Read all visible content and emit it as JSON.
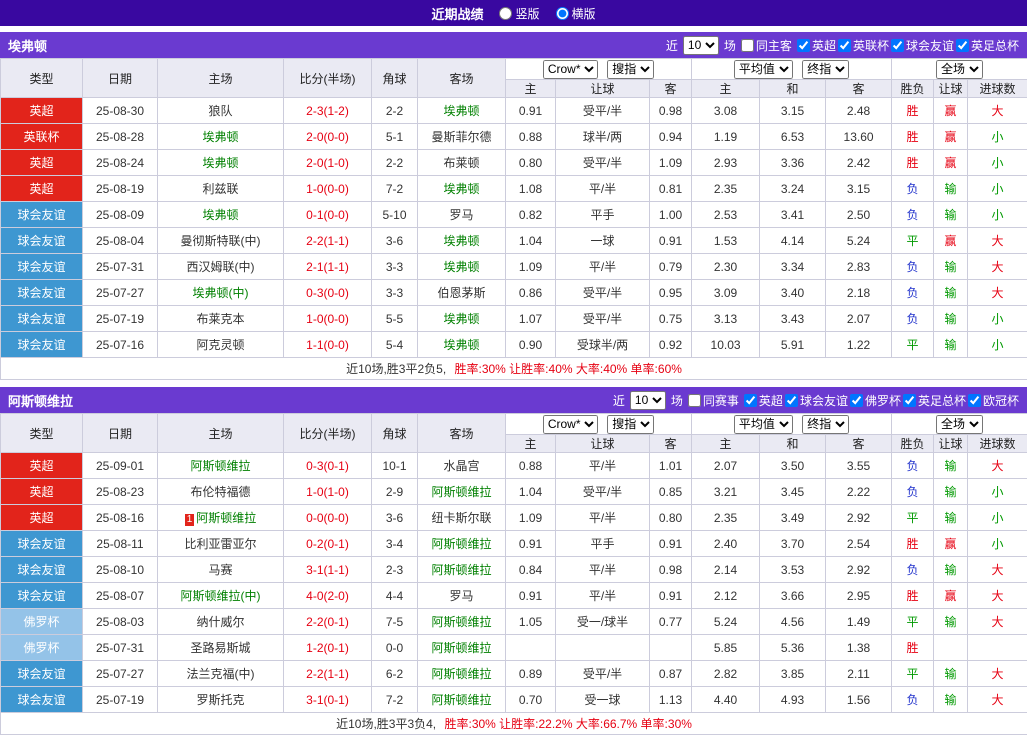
{
  "topbar": {
    "title": "近期战绩",
    "vertical": "竖版",
    "horizontal": "横版"
  },
  "filter_labels": {
    "near": "近",
    "unit": "场"
  },
  "table_header": {
    "type": "类型",
    "date": "日期",
    "home": "主场",
    "score": "比分(半场)",
    "corner": "角球",
    "away": "客场",
    "bookmaker": "Crow*",
    "odds_mode": "搜指",
    "avg": "平均值",
    "final_mode": "终指",
    "scope": "全场",
    "odds_home": "主",
    "odds_handicap": "让球",
    "odds_away": "客",
    "avg_home": "主",
    "avg_draw": "和",
    "avg_away": "客",
    "result_wl": "胜负",
    "result_handicap": "让球",
    "result_goals": "进球数"
  },
  "colors": {
    "top_bar": "#3908a0",
    "accent_bar": "#6a3ad0",
    "score": "#e60012",
    "featured_team": "#008000",
    "type_bg": {
      "英超": "#e2241b",
      "英联杯": "#e2241b",
      "球会友谊": "#3e97d1",
      "佛罗杯": "#94c3e8"
    },
    "result": {
      "胜": "#e60012",
      "平": "#009900",
      "负": "#2233cc",
      "赢": "#e60012",
      "输": "#009900",
      "大": "#e60012",
      "小": "#009900"
    }
  },
  "sections": [
    {
      "team": "埃弗顿",
      "filter": {
        "count": "10",
        "same_label": "同主客",
        "leagues": [
          "英超",
          "英联杯",
          "球会友谊",
          "英足总杯"
        ]
      },
      "rows": [
        {
          "type": "英超",
          "date": "25-08-30",
          "home": "狼队",
          "home_f": false,
          "score": "2-3(1-2)",
          "corner": "2-2",
          "away": "埃弗顿",
          "away_f": true,
          "o1": "0.91",
          "hcap": "受平/半",
          "o2": "0.98",
          "a1": "3.08",
          "a2": "3.15",
          "a3": "2.48",
          "wl": "胜",
          "hr": "赢",
          "gr": "大"
        },
        {
          "type": "英联杯",
          "date": "25-08-28",
          "home": "埃弗顿",
          "home_f": true,
          "score": "2-0(0-0)",
          "corner": "5-1",
          "away": "曼斯菲尔德",
          "away_f": false,
          "o1": "0.88",
          "hcap": "球半/两",
          "o2": "0.94",
          "a1": "1.19",
          "a2": "6.53",
          "a3": "13.60",
          "wl": "胜",
          "hr": "赢",
          "gr": "小"
        },
        {
          "type": "英超",
          "date": "25-08-24",
          "home": "埃弗顿",
          "home_f": true,
          "score": "2-0(1-0)",
          "corner": "2-2",
          "away": "布莱顿",
          "away_f": false,
          "o1": "0.80",
          "hcap": "受平/半",
          "o2": "1.09",
          "a1": "2.93",
          "a2": "3.36",
          "a3": "2.42",
          "wl": "胜",
          "hr": "赢",
          "gr": "小"
        },
        {
          "type": "英超",
          "date": "25-08-19",
          "home": "利兹联",
          "home_f": false,
          "score": "1-0(0-0)",
          "corner": "7-2",
          "away": "埃弗顿",
          "away_f": true,
          "o1": "1.08",
          "hcap": "平/半",
          "o2": "0.81",
          "a1": "2.35",
          "a2": "3.24",
          "a3": "3.15",
          "wl": "负",
          "hr": "输",
          "gr": "小"
        },
        {
          "type": "球会友谊",
          "date": "25-08-09",
          "home": "埃弗顿",
          "home_f": true,
          "score": "0-1(0-0)",
          "corner": "5-10",
          "away": "罗马",
          "away_f": false,
          "o1": "0.82",
          "hcap": "平手",
          "o2": "1.00",
          "a1": "2.53",
          "a2": "3.41",
          "a3": "2.50",
          "wl": "负",
          "hr": "输",
          "gr": "小"
        },
        {
          "type": "球会友谊",
          "date": "25-08-04",
          "home": "曼彻斯特联(中)",
          "home_f": false,
          "score": "2-2(1-1)",
          "corner": "3-6",
          "away": "埃弗顿",
          "away_f": true,
          "o1": "1.04",
          "hcap": "一球",
          "o2": "0.91",
          "a1": "1.53",
          "a2": "4.14",
          "a3": "5.24",
          "wl": "平",
          "hr": "赢",
          "gr": "大"
        },
        {
          "type": "球会友谊",
          "date": "25-07-31",
          "home": "西汉姆联(中)",
          "home_f": false,
          "score": "2-1(1-1)",
          "corner": "3-3",
          "away": "埃弗顿",
          "away_f": true,
          "o1": "1.09",
          "hcap": "平/半",
          "o2": "0.79",
          "a1": "2.30",
          "a2": "3.34",
          "a3": "2.83",
          "wl": "负",
          "hr": "输",
          "gr": "大"
        },
        {
          "type": "球会友谊",
          "date": "25-07-27",
          "home": "埃弗顿(中)",
          "home_f": true,
          "score": "0-3(0-0)",
          "corner": "3-3",
          "away": "伯恩茅斯",
          "away_f": false,
          "o1": "0.86",
          "hcap": "受平/半",
          "o2": "0.95",
          "a1": "3.09",
          "a2": "3.40",
          "a3": "2.18",
          "wl": "负",
          "hr": "输",
          "gr": "大"
        },
        {
          "type": "球会友谊",
          "date": "25-07-19",
          "home": "布莱克本",
          "home_f": false,
          "score": "1-0(0-0)",
          "corner": "5-5",
          "away": "埃弗顿",
          "away_f": true,
          "o1": "1.07",
          "hcap": "受平/半",
          "o2": "0.75",
          "a1": "3.13",
          "a2": "3.43",
          "a3": "2.07",
          "wl": "负",
          "hr": "输",
          "gr": "小"
        },
        {
          "type": "球会友谊",
          "date": "25-07-16",
          "home": "阿克灵顿",
          "home_f": false,
          "score": "1-1(0-0)",
          "corner": "5-4",
          "away": "埃弗顿",
          "away_f": true,
          "o1": "0.90",
          "hcap": "受球半/两",
          "o2": "0.92",
          "a1": "10.03",
          "a2": "5.91",
          "a3": "1.22",
          "wl": "平",
          "hr": "输",
          "gr": "小"
        }
      ],
      "summary": {
        "prefix": "近10场,胜3平2负5,",
        "stats": "胜率:30% 让胜率:40% 大率:40% 单率:60%"
      }
    },
    {
      "team": "阿斯顿维拉",
      "filter": {
        "count": "10",
        "same_label": "同赛事",
        "leagues": [
          "英超",
          "球会友谊",
          "佛罗杯",
          "英足总杯",
          "欧冠杯"
        ]
      },
      "rows": [
        {
          "type": "英超",
          "date": "25-09-01",
          "home": "阿斯顿维拉",
          "home_f": true,
          "score": "0-3(0-1)",
          "corner": "10-1",
          "away": "水晶宫",
          "away_f": false,
          "o1": "0.88",
          "hcap": "平/半",
          "o2": "1.01",
          "a1": "2.07",
          "a2": "3.50",
          "a3": "3.55",
          "wl": "负",
          "hr": "输",
          "gr": "大"
        },
        {
          "type": "英超",
          "date": "25-08-23",
          "home": "布伦特福德",
          "home_f": false,
          "score": "1-0(1-0)",
          "corner": "2-9",
          "away": "阿斯顿维拉",
          "away_f": true,
          "o1": "1.04",
          "hcap": "受平/半",
          "o2": "0.85",
          "a1": "3.21",
          "a2": "3.45",
          "a3": "2.22",
          "wl": "负",
          "hr": "输",
          "gr": "小"
        },
        {
          "type": "英超",
          "date": "25-08-16",
          "home": "阿斯顿维拉",
          "home_f": true,
          "badge": "1",
          "score": "0-0(0-0)",
          "corner": "3-6",
          "away": "纽卡斯尔联",
          "away_f": false,
          "o1": "1.09",
          "hcap": "平/半",
          "o2": "0.80",
          "a1": "2.35",
          "a2": "3.49",
          "a3": "2.92",
          "wl": "平",
          "hr": "输",
          "gr": "小"
        },
        {
          "type": "球会友谊",
          "date": "25-08-11",
          "home": "比利亚雷亚尔",
          "home_f": false,
          "score": "0-2(0-1)",
          "corner": "3-4",
          "away": "阿斯顿维拉",
          "away_f": true,
          "o1": "0.91",
          "hcap": "平手",
          "o2": "0.91",
          "a1": "2.40",
          "a2": "3.70",
          "a3": "2.54",
          "wl": "胜",
          "hr": "赢",
          "gr": "小"
        },
        {
          "type": "球会友谊",
          "date": "25-08-10",
          "home": "马赛",
          "home_f": false,
          "score": "3-1(1-1)",
          "corner": "2-3",
          "away": "阿斯顿维拉",
          "away_f": true,
          "o1": "0.84",
          "hcap": "平/半",
          "o2": "0.98",
          "a1": "2.14",
          "a2": "3.53",
          "a3": "2.92",
          "wl": "负",
          "hr": "输",
          "gr": "大"
        },
        {
          "type": "球会友谊",
          "date": "25-08-07",
          "home": "阿斯顿维拉(中)",
          "home_f": true,
          "score": "4-0(2-0)",
          "corner": "4-4",
          "away": "罗马",
          "away_f": false,
          "o1": "0.91",
          "hcap": "平/半",
          "o2": "0.91",
          "a1": "2.12",
          "a2": "3.66",
          "a3": "2.95",
          "wl": "胜",
          "hr": "赢",
          "gr": "大"
        },
        {
          "type": "佛罗杯",
          "date": "25-08-03",
          "home": "纳什威尔",
          "home_f": false,
          "score": "2-2(0-1)",
          "corner": "7-5",
          "away": "阿斯顿维拉",
          "away_f": true,
          "o1": "1.05",
          "hcap": "受一/球半",
          "o2": "0.77",
          "a1": "5.24",
          "a2": "4.56",
          "a3": "1.49",
          "wl": "平",
          "hr": "输",
          "gr": "大"
        },
        {
          "type": "佛罗杯",
          "date": "25-07-31",
          "home": "圣路易斯城",
          "home_f": false,
          "score": "1-2(0-1)",
          "corner": "0-0",
          "away": "阿斯顿维拉",
          "away_f": true,
          "o1": "",
          "hcap": "",
          "o2": "",
          "a1": "5.85",
          "a2": "5.36",
          "a3": "1.38",
          "wl": "胜",
          "hr": "",
          "gr": ""
        },
        {
          "type": "球会友谊",
          "date": "25-07-27",
          "home": "法兰克福(中)",
          "home_f": false,
          "score": "2-2(1-1)",
          "corner": "6-2",
          "away": "阿斯顿维拉",
          "away_f": true,
          "o1": "0.89",
          "hcap": "受平/半",
          "o2": "0.87",
          "a1": "2.82",
          "a2": "3.85",
          "a3": "2.11",
          "wl": "平",
          "hr": "输",
          "gr": "大"
        },
        {
          "type": "球会友谊",
          "date": "25-07-19",
          "home": "罗斯托克",
          "home_f": false,
          "score": "3-1(0-1)",
          "corner": "7-2",
          "away": "阿斯顿维拉",
          "away_f": true,
          "o1": "0.70",
          "hcap": "受一球",
          "o2": "1.13",
          "a1": "4.40",
          "a2": "4.93",
          "a3": "1.56",
          "wl": "负",
          "hr": "输",
          "gr": "大"
        }
      ],
      "summary": {
        "prefix": "近10场,胜3平3负4,",
        "stats": "胜率:30% 让胜率:22.2% 大率:66.7% 单率:30%"
      }
    }
  ]
}
